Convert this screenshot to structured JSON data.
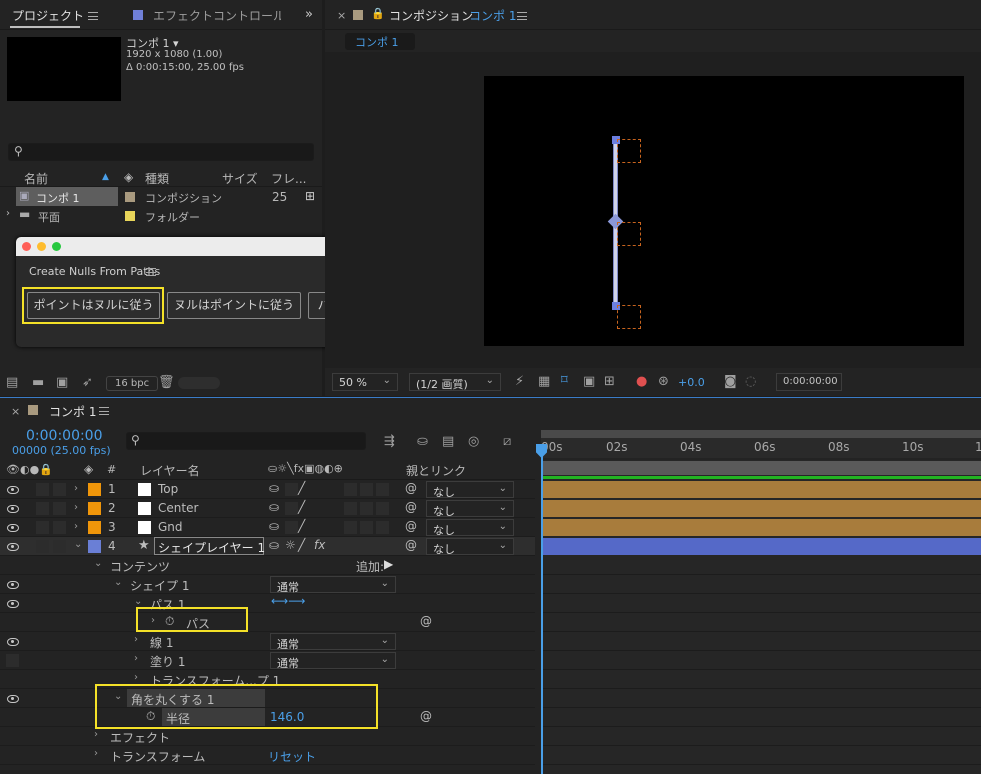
{
  "project": {
    "tab_label": "プロジェクト",
    "effect_tab_label": "エフェクトコントロール",
    "comp_name": "コンポ 1 ▾",
    "comp_res": "1920 x 1080 (1.00)",
    "comp_dur": "Δ 0:00:15:00, 25.00 fps",
    "search_placeholder": "",
    "col_name": "名前",
    "col_type": "種類",
    "col_size": "サイズ",
    "col_frame": "フレ...",
    "items": [
      {
        "name": "コンポ 1",
        "type": "コンポジション",
        "frame": "25",
        "color": "#a99a7f"
      },
      {
        "name": "平面",
        "type": "フォルダー",
        "frame": "",
        "color": "#e8d55a"
      }
    ],
    "bpc": "16 bpc"
  },
  "dialog": {
    "title": "Create Nulls From Paths",
    "btn1": "ポイントはヌルに従う",
    "btn2": "ヌルはポイントに従う",
    "btn3": "パスをトレース"
  },
  "composition": {
    "tab_label": "コンポジション",
    "tab_comp": "コンポ 1",
    "sub_tab": "コンポ 1",
    "zoom": "50 %",
    "quality": "(1/2 画質)",
    "exposure": "+0.0",
    "timecode": "0:00:00:00"
  },
  "timeline": {
    "tab_label": "コンポ 1",
    "timecode": "0:00:00:00",
    "frames": "00000 (25.00 fps)",
    "col_num": "#",
    "col_layer": "レイヤー名",
    "col_parent": "親とリンク",
    "layers": [
      {
        "num": "1",
        "name": "Top",
        "parent": "なし",
        "label": "#f0960a"
      },
      {
        "num": "2",
        "name": "Center",
        "parent": "なし",
        "label": "#f0960a"
      },
      {
        "num": "3",
        "name": "Gnd",
        "parent": "なし",
        "label": "#f0960a"
      },
      {
        "num": "4",
        "name": "シェイプレイヤー 1",
        "parent": "なし",
        "label": "#6a7fd6"
      }
    ],
    "contents": "コンテンツ",
    "add_label": "追加:",
    "shape1": "シェイプ 1",
    "shape1_mode": "通常",
    "path1": "パス 1",
    "path": "パス",
    "stroke1": "線 1",
    "stroke1_mode": "通常",
    "fill1": "塗り 1",
    "fill1_mode": "通常",
    "transform_sub": "トランスフォーム...プ 1",
    "round_corners": "角を丸くする 1",
    "radius_label": "半径",
    "radius_value": "146.0",
    "effects": "エフェクト",
    "transform": "トランスフォーム",
    "reset": "リセット",
    "ticks": [
      "00s",
      "02s",
      "04s",
      "06s",
      "08s",
      "10s",
      "1"
    ]
  },
  "colors": {
    "accent": "#4a9fe8",
    "highlight": "#f4e128",
    "shape_bar": "#5569c8",
    "layer_bar": "#a87c3c"
  }
}
